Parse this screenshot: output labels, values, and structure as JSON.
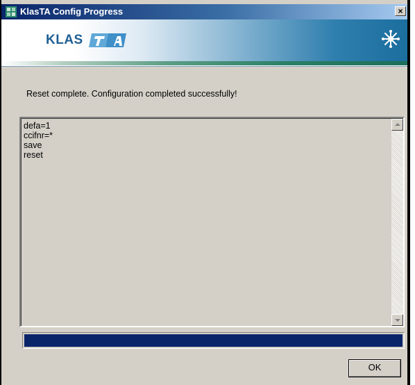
{
  "window": {
    "title": "KlasTA Config Progress",
    "close_glyph": "×",
    "app_icon": "app-grid-icon"
  },
  "banner": {
    "logo_text": "KLAS",
    "logo_mark": "TA-logo-mark",
    "right_icon": "snowflake-star-icon"
  },
  "status": {
    "message": "Reset complete. Configuration completed successfully!"
  },
  "log": {
    "lines": [
      "defa=1",
      "ccifnr=*",
      "save",
      "reset"
    ]
  },
  "progress": {
    "value_percent": 100,
    "fill_color": "#0a246a"
  },
  "buttons": {
    "ok_label": "OK"
  },
  "colors": {
    "titlebar_start": "#0a246a",
    "dialog_face": "#d4d0c8",
    "logo_blue": "#1f5f93"
  }
}
